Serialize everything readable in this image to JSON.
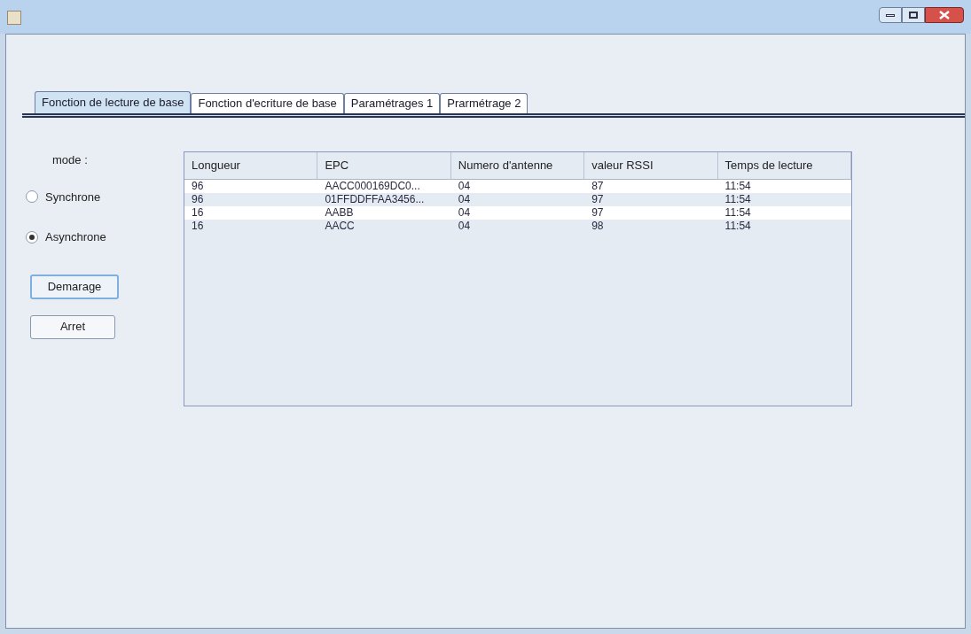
{
  "tabs": [
    {
      "label": "Fonction de lecture de base",
      "selected": true
    },
    {
      "label": "Fonction d'ecriture de base",
      "selected": false
    },
    {
      "label": "Paramétrages 1",
      "selected": false
    },
    {
      "label": "Prarmétrage 2",
      "selected": false
    }
  ],
  "mode_label": "mode :",
  "modes": [
    {
      "label": "Synchrone",
      "selected": false
    },
    {
      "label": "Asynchrone",
      "selected": true
    }
  ],
  "buttons": [
    {
      "label": "Demarage",
      "focused": true
    },
    {
      "label": "Arret",
      "focused": false
    }
  ],
  "table": {
    "columns": [
      "Longueur",
      "EPC",
      "Numero d'antenne",
      "valeur RSSI",
      "Temps de lecture"
    ],
    "rows": [
      [
        "96",
        "AACC000169DC0...",
        "04",
        "87",
        "11:54"
      ],
      [
        "96",
        "01FFDDFFAA3456...",
        "04",
        "97",
        "11:54"
      ],
      [
        "16",
        "AABB",
        "04",
        "97",
        "11:54"
      ],
      [
        "16",
        "AACC",
        "04",
        "98",
        "11:54"
      ]
    ]
  }
}
